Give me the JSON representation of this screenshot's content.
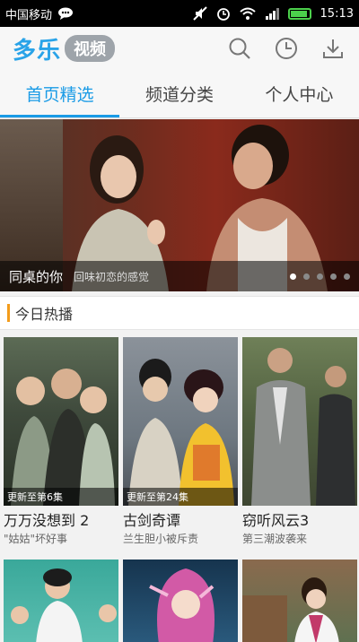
{
  "status_bar": {
    "carrier": "中国移动",
    "time": "15:13"
  },
  "app": {
    "logo_main": "多乐",
    "logo_badge": "视频"
  },
  "tabs": [
    {
      "label": "首页精选",
      "active": true
    },
    {
      "label": "频道分类",
      "active": false
    },
    {
      "label": "个人中心",
      "active": false
    }
  ],
  "banner": {
    "title": "同桌的你",
    "subtitle": "回味初恋的感觉",
    "dots": 5,
    "active_dot": 0
  },
  "section": {
    "title": "今日热播"
  },
  "cards": [
    {
      "name": "万万没想到 2",
      "desc": "\"姑姑\"坏好事",
      "episode": "更新至第6集"
    },
    {
      "name": "古剑奇谭",
      "desc": "兰生胆小被斥责",
      "episode": "更新至第24集"
    },
    {
      "name": "窃听风云3",
      "desc": "第三潮波袭来",
      "episode": ""
    }
  ],
  "colors": {
    "accent": "#1a9be6",
    "section_bar": "#f39c1b"
  }
}
